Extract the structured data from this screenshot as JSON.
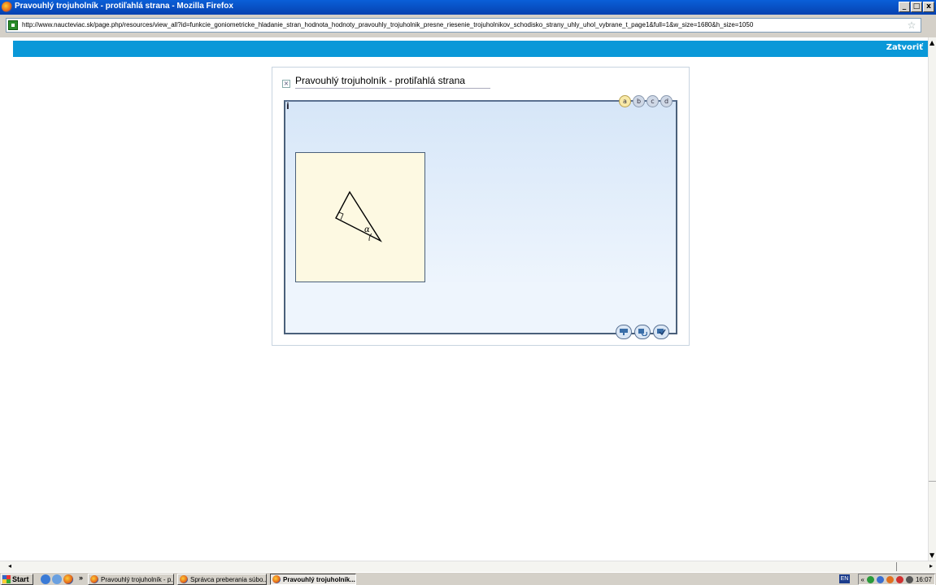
{
  "window": {
    "title": "Pravouhlý trojuholník - protiľahlá strana - Mozilla Firefox",
    "buttons": [
      "_",
      "□",
      "x"
    ]
  },
  "urlbar": {
    "url": "http://www.naucteviac.sk/page.php/resources/view_all?id=funkcie_goniometricke_hladanie_stran_hodnota_hodnoty_pravouhly_trojuholnik_presne_riesenie_trojuholnikov_schodisko_strany_uhly_uhol_vybrane_t_page1&full=1&w_size=1680&h_size=1050"
  },
  "page": {
    "close_label": "Zatvoriť"
  },
  "widget": {
    "title": "Pravouhlý trojuholník - protiľahlá strana",
    "info": "i",
    "tabs": [
      "a",
      "b",
      "c",
      "d"
    ],
    "active_tab": "a",
    "angle_label": "α"
  },
  "taskbar": {
    "start_label": "Start",
    "chevron": "»",
    "tasks": [
      "Pravouhlý trojuholník - p...",
      "Správca preberania súbo...",
      "Pravouhlý trojuholník..."
    ],
    "lang": "EN",
    "tray_chevron": "«",
    "clock": "16:07"
  }
}
